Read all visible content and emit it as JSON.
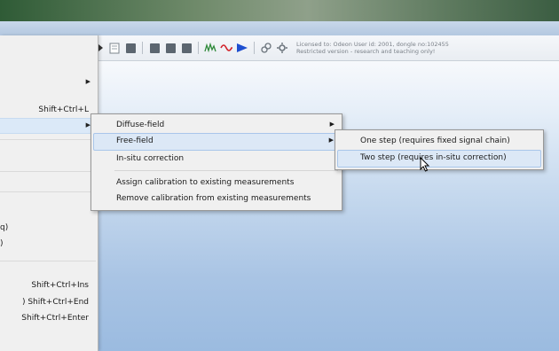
{
  "license": {
    "line1": "Licensed to: Odeon   User id: 2001, dongle no:102455",
    "line2": "Restricted version - research and teaching only!"
  },
  "parent_menu": {
    "item_shift_ctrl_l": "Shift+Ctrl+L",
    "left_frag_q": "q)",
    "left_frag_paren": ")",
    "item_ins": "Shift+Ctrl+Ins",
    "item_end": ") Shift+Ctrl+End",
    "item_enter": "Shift+Ctrl+Enter"
  },
  "calibration_menu": {
    "items": [
      {
        "label": "Diffuse-field",
        "submenu": true
      },
      {
        "label": "Free-field",
        "submenu": true
      },
      {
        "label": "In-situ correction"
      },
      {
        "label": "Assign calibration to existing measurements"
      },
      {
        "label": "Remove calibration from existing measurements"
      }
    ]
  },
  "freefield_menu": {
    "items": [
      {
        "label": "One step (requires fixed signal chain)"
      },
      {
        "label": "Two step (requires in-situ correction)"
      }
    ]
  },
  "colors": {
    "menu_bg": "#f0f0f0",
    "highlight": "#dce8f6",
    "workspace_gradient_bottom": "#9bbbe0"
  },
  "icons": [
    "expand-arrow-icon",
    "page-icon",
    "stop-icon",
    "stop-icon",
    "stop-icon",
    "stop-icon",
    "spectrum-icon",
    "waveform-icon",
    "play-icon",
    "link-icon",
    "gear-icon"
  ]
}
